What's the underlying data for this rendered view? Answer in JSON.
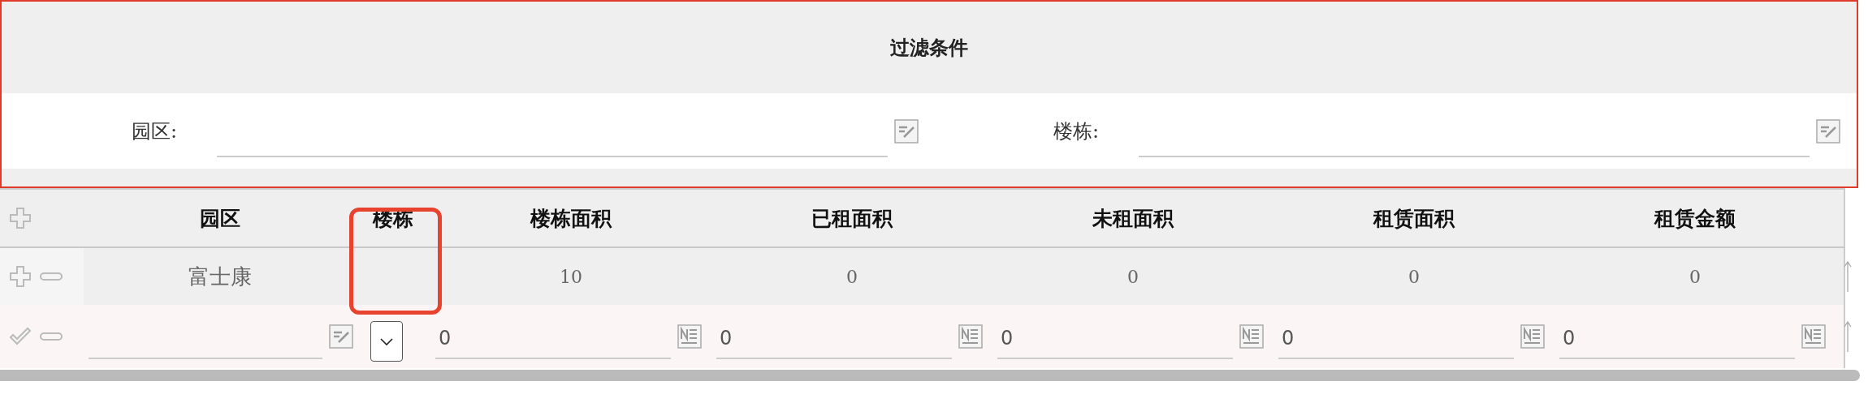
{
  "filter_panel": {
    "title": "过滤条件",
    "fields": [
      {
        "label": "园区:"
      },
      {
        "label": "楼栋:"
      }
    ]
  },
  "table": {
    "columns": [
      {
        "label": "园区",
        "highlighted": false
      },
      {
        "label": "楼栋",
        "highlighted": true
      },
      {
        "label": "楼栋面积",
        "highlighted": false
      },
      {
        "label": "已租面积",
        "highlighted": false
      },
      {
        "label": "未租面积",
        "highlighted": false
      },
      {
        "label": "租赁面积",
        "highlighted": false
      },
      {
        "label": "租赁金额",
        "highlighted": false
      }
    ],
    "rows": [
      {
        "cells": [
          "富士康",
          null,
          "10",
          "0",
          "0",
          "0",
          "0"
        ]
      }
    ],
    "edit_row": [
      {
        "kind": "text"
      },
      {
        "kind": "select"
      },
      {
        "kind": "number",
        "value": "0"
      },
      {
        "kind": "number",
        "value": "0"
      },
      {
        "kind": "number",
        "value": "0"
      },
      {
        "kind": "number",
        "value": "0"
      },
      {
        "kind": "number",
        "value": "0"
      }
    ]
  }
}
